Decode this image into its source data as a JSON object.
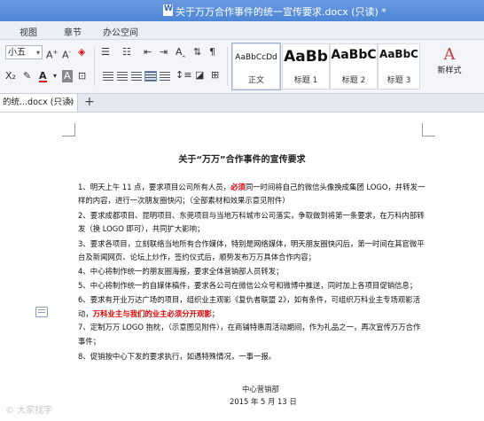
{
  "window": {
    "title": "关于万万合作事件的统一宣传要求.docx (只读) *"
  },
  "menu": [
    "视图",
    "章节",
    "办公空间"
  ],
  "toolbar": {
    "font_size": "小五",
    "styles": [
      {
        "sample": "AaBbCcDd",
        "label": "正文"
      },
      {
        "sample": "AaBb",
        "label": "标题 1"
      },
      {
        "sample": "AaBbC",
        "label": "标题 2"
      },
      {
        "sample": "AaBbC",
        "label": "标题 3"
      }
    ],
    "new_style_label": "新样式"
  },
  "tabs": [
    {
      "label": "的统...docx (只读)",
      "close": "×"
    }
  ],
  "new_tab": "+",
  "document": {
    "heading": "关于“万万”合作事件的宣传要求",
    "lines": [
      [
        "1、明天上午 11 点，要求项目公司所有人员，",
        "必须",
        "同一时间将自己的微信头像换成集团 LOGO，并转发一"
      ],
      [
        "样的内容，进行一次朋友圈快闪；（全部素材和效果示意见附件）",
        "",
        ""
      ],
      [
        "2、要求成都项目、昆明项目、东莞项目与当地万科城市公司落实，争取做到将第一条要求，在万科内部转",
        "",
        ""
      ],
      [
        "发（换 LOGO 即可），共同扩大影响；",
        "",
        ""
      ],
      [
        "3、要求各项目，立刻联络当地所有合作媒体，特别是网络媒体，明天朋友圈快闪后，第一时间在其官微平",
        "",
        ""
      ],
      [
        "台及新闻网页、论坛上炒作，签约仪式后，顺势发布万万具体合作内容；",
        "",
        ""
      ],
      [
        "4、中心将制作统一的朋友圈海报，要求全体营销部人员转发；",
        "",
        ""
      ],
      [
        "5、中心将制作统一的自媒体稿件，要求各公司在微信公众号和微博中推送，同时加上各项目促销信息；",
        "",
        ""
      ],
      [
        "6、要求有开业万达广场的项目，组织业主观影《复仇者联盟 2》，如有条件，可组织万科业主专场观影活",
        "",
        ""
      ],
      [
        "动，",
        "万科业主与我们的业主必须分开观影",
        "；"
      ],
      [
        "7、定制万万 LOGO 抱枕，（示意图见附件），在商铺特惠周活动期间，作为礼品之一，再次宣传万万合作",
        "",
        ""
      ],
      [
        "事件；",
        "",
        ""
      ],
      [
        "8、促销按中心下发的要求执行，如遇特殊情况，一事一报。",
        "",
        ""
      ]
    ],
    "signature": {
      "dept": "中心营销部",
      "date": "2015 年 5 月 13 日"
    }
  },
  "watermark": "© 大家找字"
}
